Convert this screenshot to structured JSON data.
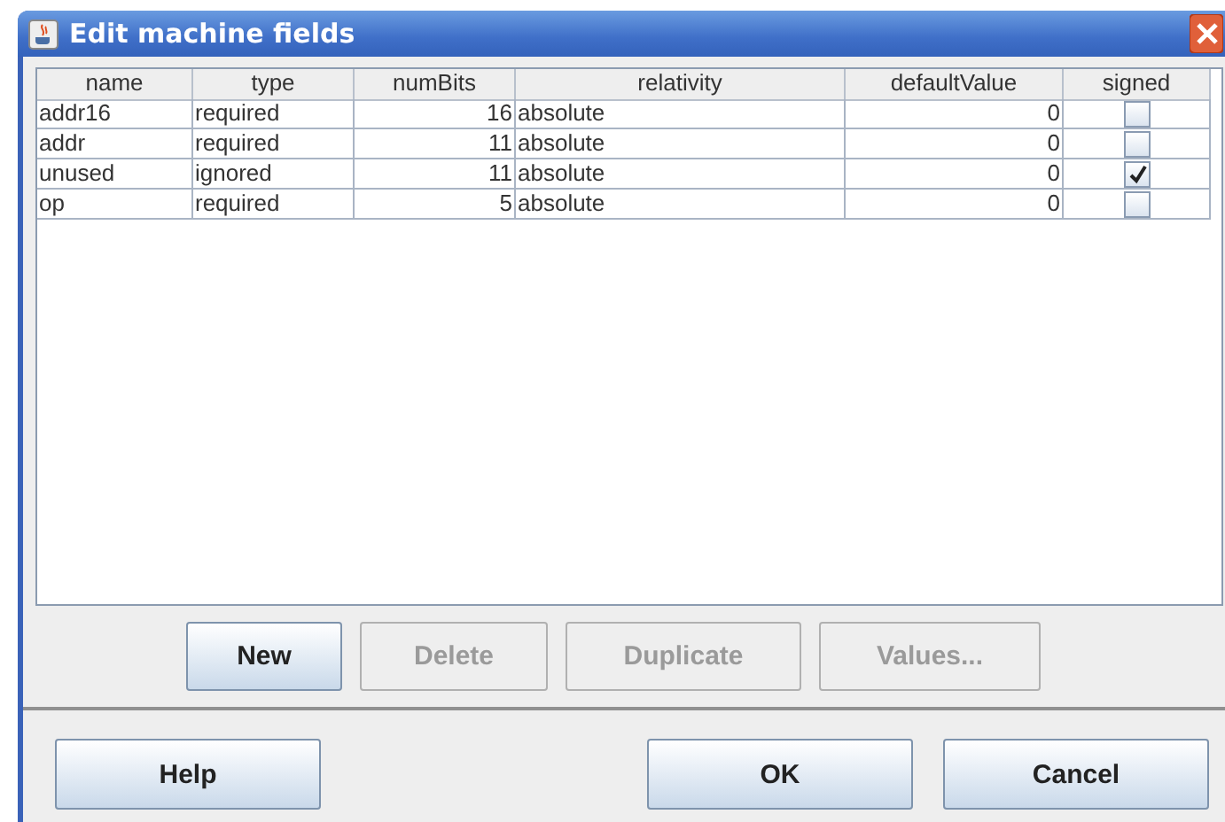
{
  "window": {
    "title": "Edit machine fields"
  },
  "table": {
    "columns": [
      "name",
      "type",
      "numBits",
      "relativity",
      "defaultValue",
      "signed"
    ],
    "rows": [
      {
        "name": "addr16",
        "type": "required",
        "numBits": "16",
        "relativity": "absolute",
        "defaultValue": "0",
        "signed": false
      },
      {
        "name": "addr",
        "type": "required",
        "numBits": "11",
        "relativity": "absolute",
        "defaultValue": "0",
        "signed": false
      },
      {
        "name": "unused",
        "type": "ignored",
        "numBits": "11",
        "relativity": "absolute",
        "defaultValue": "0",
        "signed": true
      },
      {
        "name": "op",
        "type": "required",
        "numBits": "5",
        "relativity": "absolute",
        "defaultValue": "0",
        "signed": false
      }
    ]
  },
  "table_buttons": [
    {
      "label": "New",
      "disabled": false
    },
    {
      "label": "Delete",
      "disabled": true
    },
    {
      "label": "Duplicate",
      "disabled": true
    },
    {
      "label": "Values...",
      "disabled": true
    }
  ],
  "dialog_buttons": [
    {
      "label": "Help"
    },
    {
      "label": "OK"
    },
    {
      "label": "Cancel"
    }
  ]
}
